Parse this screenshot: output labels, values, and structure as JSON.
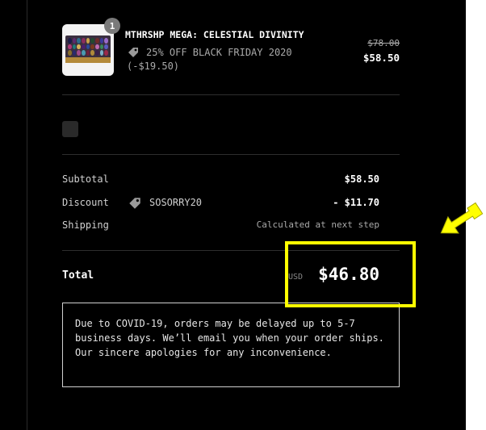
{
  "line_item": {
    "quantity": "1",
    "title": "MTHRSHP MEGA: CELESTIAL DIVINITY",
    "discount_label": "25% OFF BLACK FRIDAY 2020",
    "discount_amount": "(-$19.50)",
    "original_price": "$78.00",
    "price": "$58.50"
  },
  "summary": {
    "subtotal_label": "Subtotal",
    "subtotal_value": "$58.50",
    "discount_label": "Discount",
    "discount_code": "SOSORRY20",
    "discount_value": "- $11.70",
    "shipping_label": "Shipping",
    "shipping_value": "Calculated at next step",
    "total_label": "Total",
    "currency": "USD",
    "total_value": "$46.80"
  },
  "notice": "Due to COVID-19, orders may be delayed up to 5-7 business days. We’ll email you when your order ships. Our sincere apologies for any inconvenience.",
  "colors": {
    "panel_bg": "#000000",
    "highlight": "#ffff00",
    "badge": "#7a7a7a"
  },
  "icons": [
    "tag-icon",
    "arrow-icon"
  ]
}
